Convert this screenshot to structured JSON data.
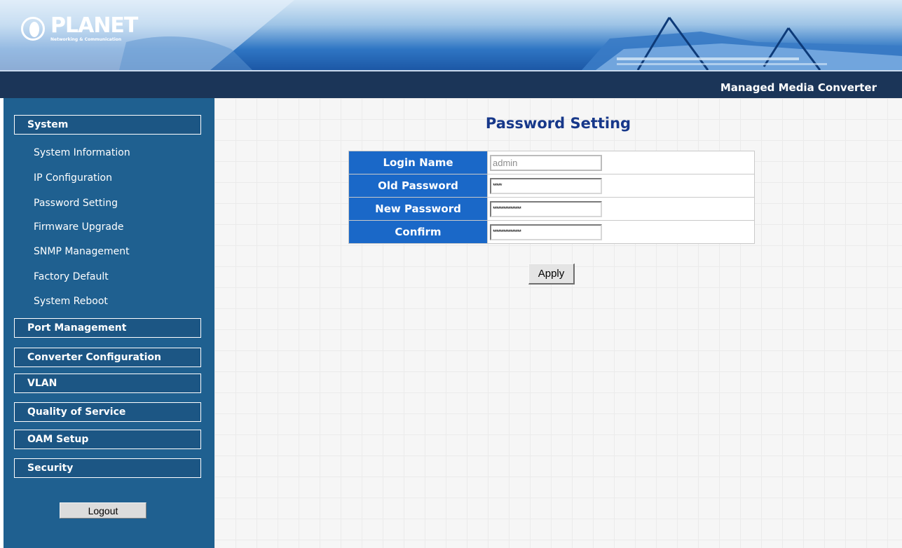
{
  "header": {
    "logo_name": "PLANET",
    "logo_tagline": "Networking & Communication",
    "product_name": "Managed Media Converter"
  },
  "sidebar": {
    "groups": [
      {
        "label": "System"
      },
      {
        "label": "Port Management"
      },
      {
        "label": "Converter Configuration"
      },
      {
        "label": "VLAN"
      },
      {
        "label": "Quality of Service"
      },
      {
        "label": "OAM Setup"
      },
      {
        "label": "Security"
      }
    ],
    "system_items": [
      {
        "label": "System Information"
      },
      {
        "label": "IP Configuration"
      },
      {
        "label": "Password Setting"
      },
      {
        "label": "Firmware Upgrade"
      },
      {
        "label": "SNMP Management"
      },
      {
        "label": "Factory Default"
      },
      {
        "label": "System Reboot"
      }
    ],
    "logout_label": "Logout"
  },
  "main": {
    "title": "Password Setting",
    "fields": [
      {
        "label": "Login Name",
        "value": "admin"
      },
      {
        "label": "Old Password",
        "value": "*****"
      },
      {
        "label": "New Password",
        "value": "****************"
      },
      {
        "label": "Confirm",
        "value": "****************"
      }
    ],
    "apply_label": "Apply"
  },
  "colors": {
    "sidebar_bg": "#1f6090",
    "title_bar": "#1b3558",
    "label_cell": "#1a68c8",
    "page_title": "#17388a"
  }
}
